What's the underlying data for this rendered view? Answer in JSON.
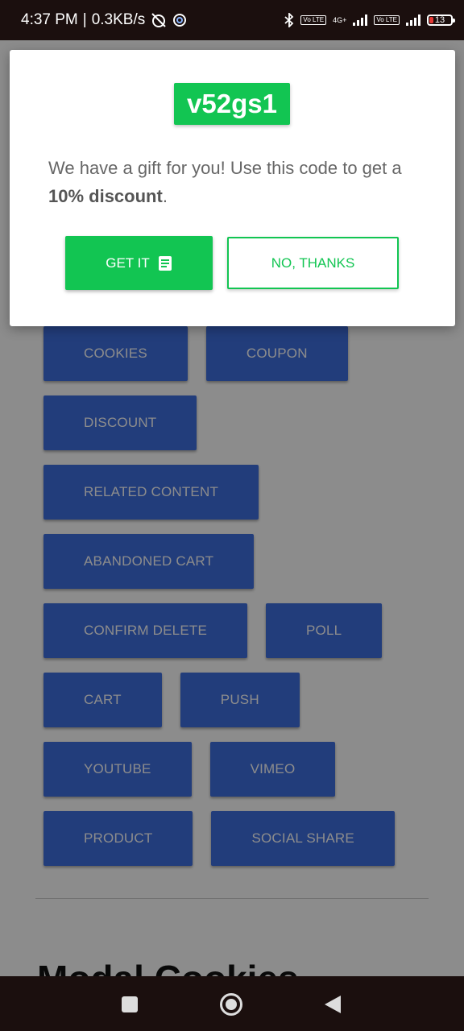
{
  "status_bar": {
    "time": "4:37 PM",
    "net_speed": "0.3KB/s",
    "separator": "|",
    "network_4g": "4G+",
    "volte": "Vo LTE",
    "battery": "13",
    "icons": [
      "alarm-off-icon",
      "app-notification-icon",
      "bluetooth-icon",
      "volte-icon",
      "signal-icon",
      "battery-icon"
    ]
  },
  "modal": {
    "code": "v52gs1",
    "message_before": "We have a gift for you! Use this code to get a ",
    "message_bold": "10% discount",
    "message_after": ".",
    "get_label": "GET IT",
    "get_icon": "book-icon",
    "no_label": "NO, THANKS",
    "accent": "#12c552"
  },
  "page": {
    "buttons": [
      [
        "COOKIES",
        "COUPON"
      ],
      [
        "DISCOUNT"
      ],
      [
        "RELATED CONTENT"
      ],
      [
        "ABANDONED CART"
      ],
      [
        "CONFIRM DELETE",
        "POLL"
      ],
      [
        "CART",
        "PUSH"
      ],
      [
        "YOUTUBE",
        "VIMEO"
      ],
      [
        "PRODUCT",
        "SOCIAL SHARE"
      ]
    ],
    "section_title": "Modal Cookies",
    "button_color": "#3f6fe0"
  },
  "nav_bar": {
    "icons": [
      "recents-square-icon",
      "home-circle-icon",
      "back-triangle-icon"
    ]
  }
}
